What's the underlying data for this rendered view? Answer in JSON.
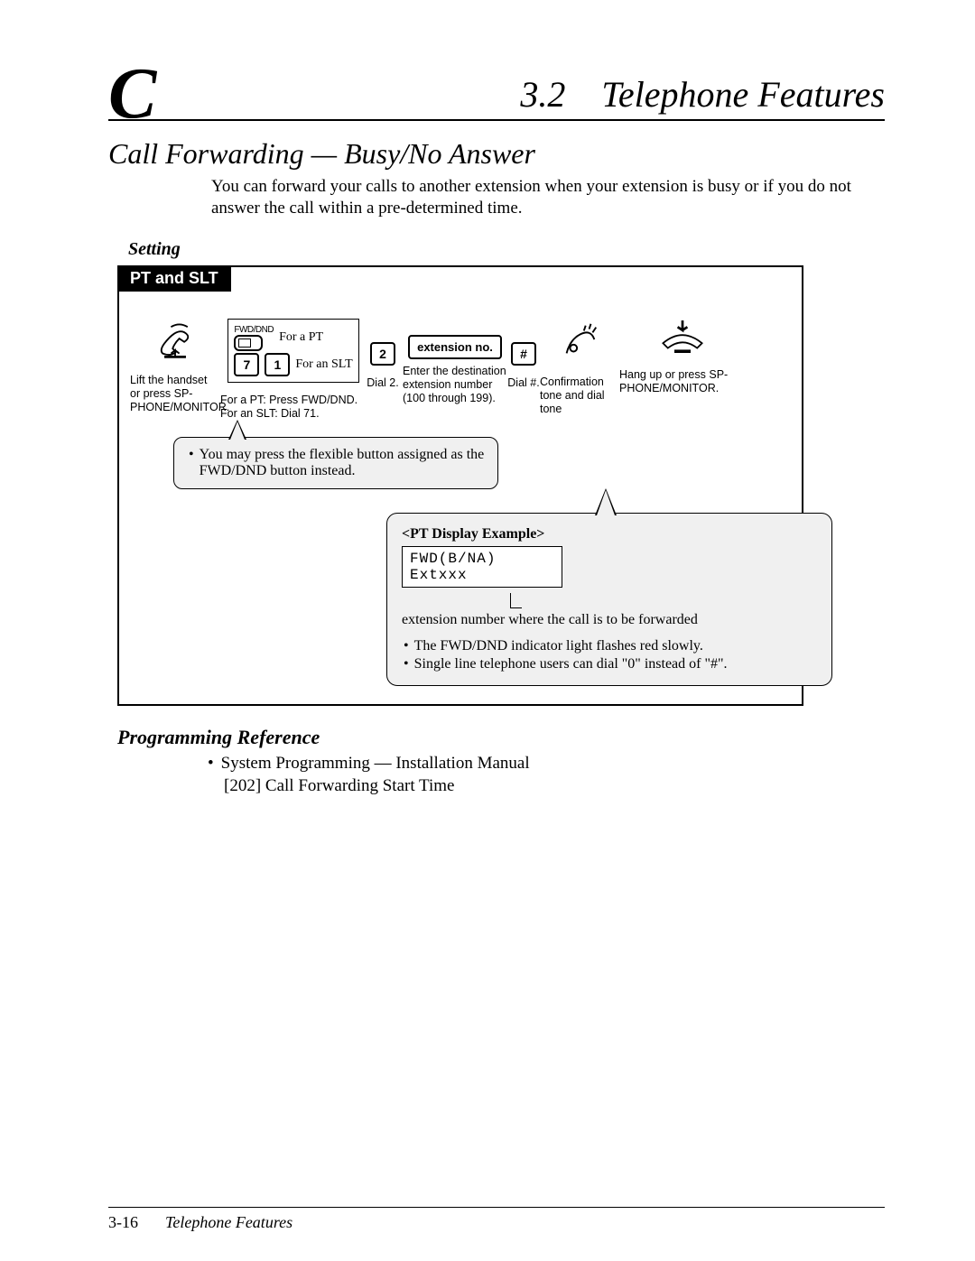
{
  "header": {
    "chapter_letter": "C",
    "section_number": "3.2",
    "section_title": "Telephone Features"
  },
  "title": "Call Forwarding — Busy/No Answer",
  "intro": "You can forward your calls to another extension when your extension is busy or if you do not answer the call within a pre-determined time.",
  "setting_heading": "Setting",
  "box_tab": "PT and SLT",
  "flow": {
    "step1_caption": "Lift the handset or press SP-PHONE/MONITOR.",
    "pt_slt": {
      "fwd_label": "FWD/DND",
      "pt_text": "For a PT",
      "key7": "7",
      "key1": "1",
      "slt_text": "For an SLT"
    },
    "step2_caption": "For a PT: Press FWD/DND. For an SLT: Dial 71.",
    "key2": "2",
    "step3_caption": "Dial 2.",
    "ext_box": "extension no.",
    "step4_caption": "Enter the destination extension number (100 through 199).",
    "key_hash": "#",
    "step5_caption": "Dial #.",
    "step6_caption": "Confirmation tone and dial tone",
    "step7_caption": "Hang up or press SP-PHONE/MONITOR."
  },
  "note1": "You may press the flexible button assigned as the FWD/DND button instead.",
  "bubble": {
    "title": "<PT Display Example>",
    "lcd": "FWD(B/NA) Extxxx",
    "leader_text": "extension number where the call is to be forwarded",
    "bullet1": "The FWD/DND indicator light flashes red slowly.",
    "bullet2": "Single line telephone users can dial \"0\" instead of \"#\"."
  },
  "prog_heading": "Programming Reference",
  "prog_bullet": "System Programming — Installation Manual",
  "prog_item": "[202]  Call Forwarding Start Time",
  "footer": {
    "page": "3-16",
    "title": "Telephone Features"
  }
}
